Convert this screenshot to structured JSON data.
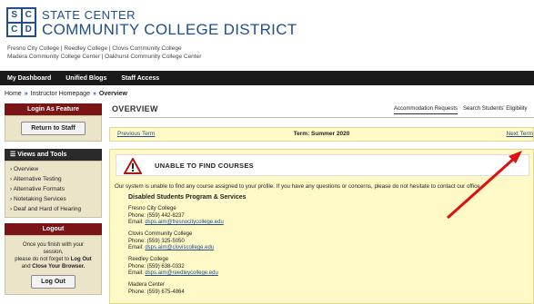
{
  "header": {
    "logo_letters": [
      "S",
      "C",
      "C",
      "D"
    ],
    "org_line1": "STATE CENTER",
    "org_line2": "COMMUNITY COLLEGE DISTRICT",
    "colleges_line1": "Fresno City College | Reedley College | Clovis Community College",
    "colleges_line2": "Madera Community College Center | Oakhurst Community College Center",
    "brand_color": "#1f4e8c"
  },
  "navbar": {
    "items": [
      "My Dashboard",
      "Unified Blogs",
      "Staff Access"
    ]
  },
  "breadcrumb": {
    "items": [
      "Home",
      "Instructor Homepage",
      "Overview"
    ],
    "separator": "»"
  },
  "sidebar": {
    "login_head": "Login As Feature",
    "return_button": "Return to Staff",
    "views_head": "Views and Tools",
    "views_items": [
      "Overview",
      "Alternative Testing",
      "Alternative Formats",
      "Notetaking Services",
      "Deaf and Hard of Hearing"
    ],
    "logout_head": "Logout",
    "logout_text_1": "Once you finish with your session,",
    "logout_text_2": "please do not forget to",
    "logout_text_bold_1": "Log Out",
    "logout_text_3": "and",
    "logout_text_bold_2": "Close Your Browser.",
    "logout_button": "Log Out",
    "accent_color": "#7a1416"
  },
  "main": {
    "title": "OVERVIEW",
    "tabs": [
      "Accommodation Requests",
      "Search Students' Eligibility"
    ],
    "prev_term": "Previous Term",
    "term_label": "Term: Summer 2020",
    "next_term": "Next Term",
    "alert_title": "UNABLE TO FIND COURSES",
    "message": "Our system is unable to find any course assigned to your profile. If you have any questions or concerns, please do not hesitate to contact our office.",
    "dsps_title": "Disabled Students Program & Services",
    "contacts": [
      {
        "name": "Fresno City College",
        "phone": "Phone: (559) 442-8237",
        "email_label": "Email:",
        "email": "dsps.aim@fresnocitycollege.edu"
      },
      {
        "name": "Clovis Community College",
        "phone": "Phone: (559) 325-5050",
        "email_label": "Email:",
        "email": "dsps.aim@cloviscollege.edu"
      },
      {
        "name": "Reedley College",
        "phone": "Phone: (559) 638-0332",
        "email_label": "Email:",
        "email": "dsps.aim@reedleycollege.edu"
      },
      {
        "name": "Madera Center",
        "phone": "Phone: (559) 675-4864"
      }
    ]
  }
}
